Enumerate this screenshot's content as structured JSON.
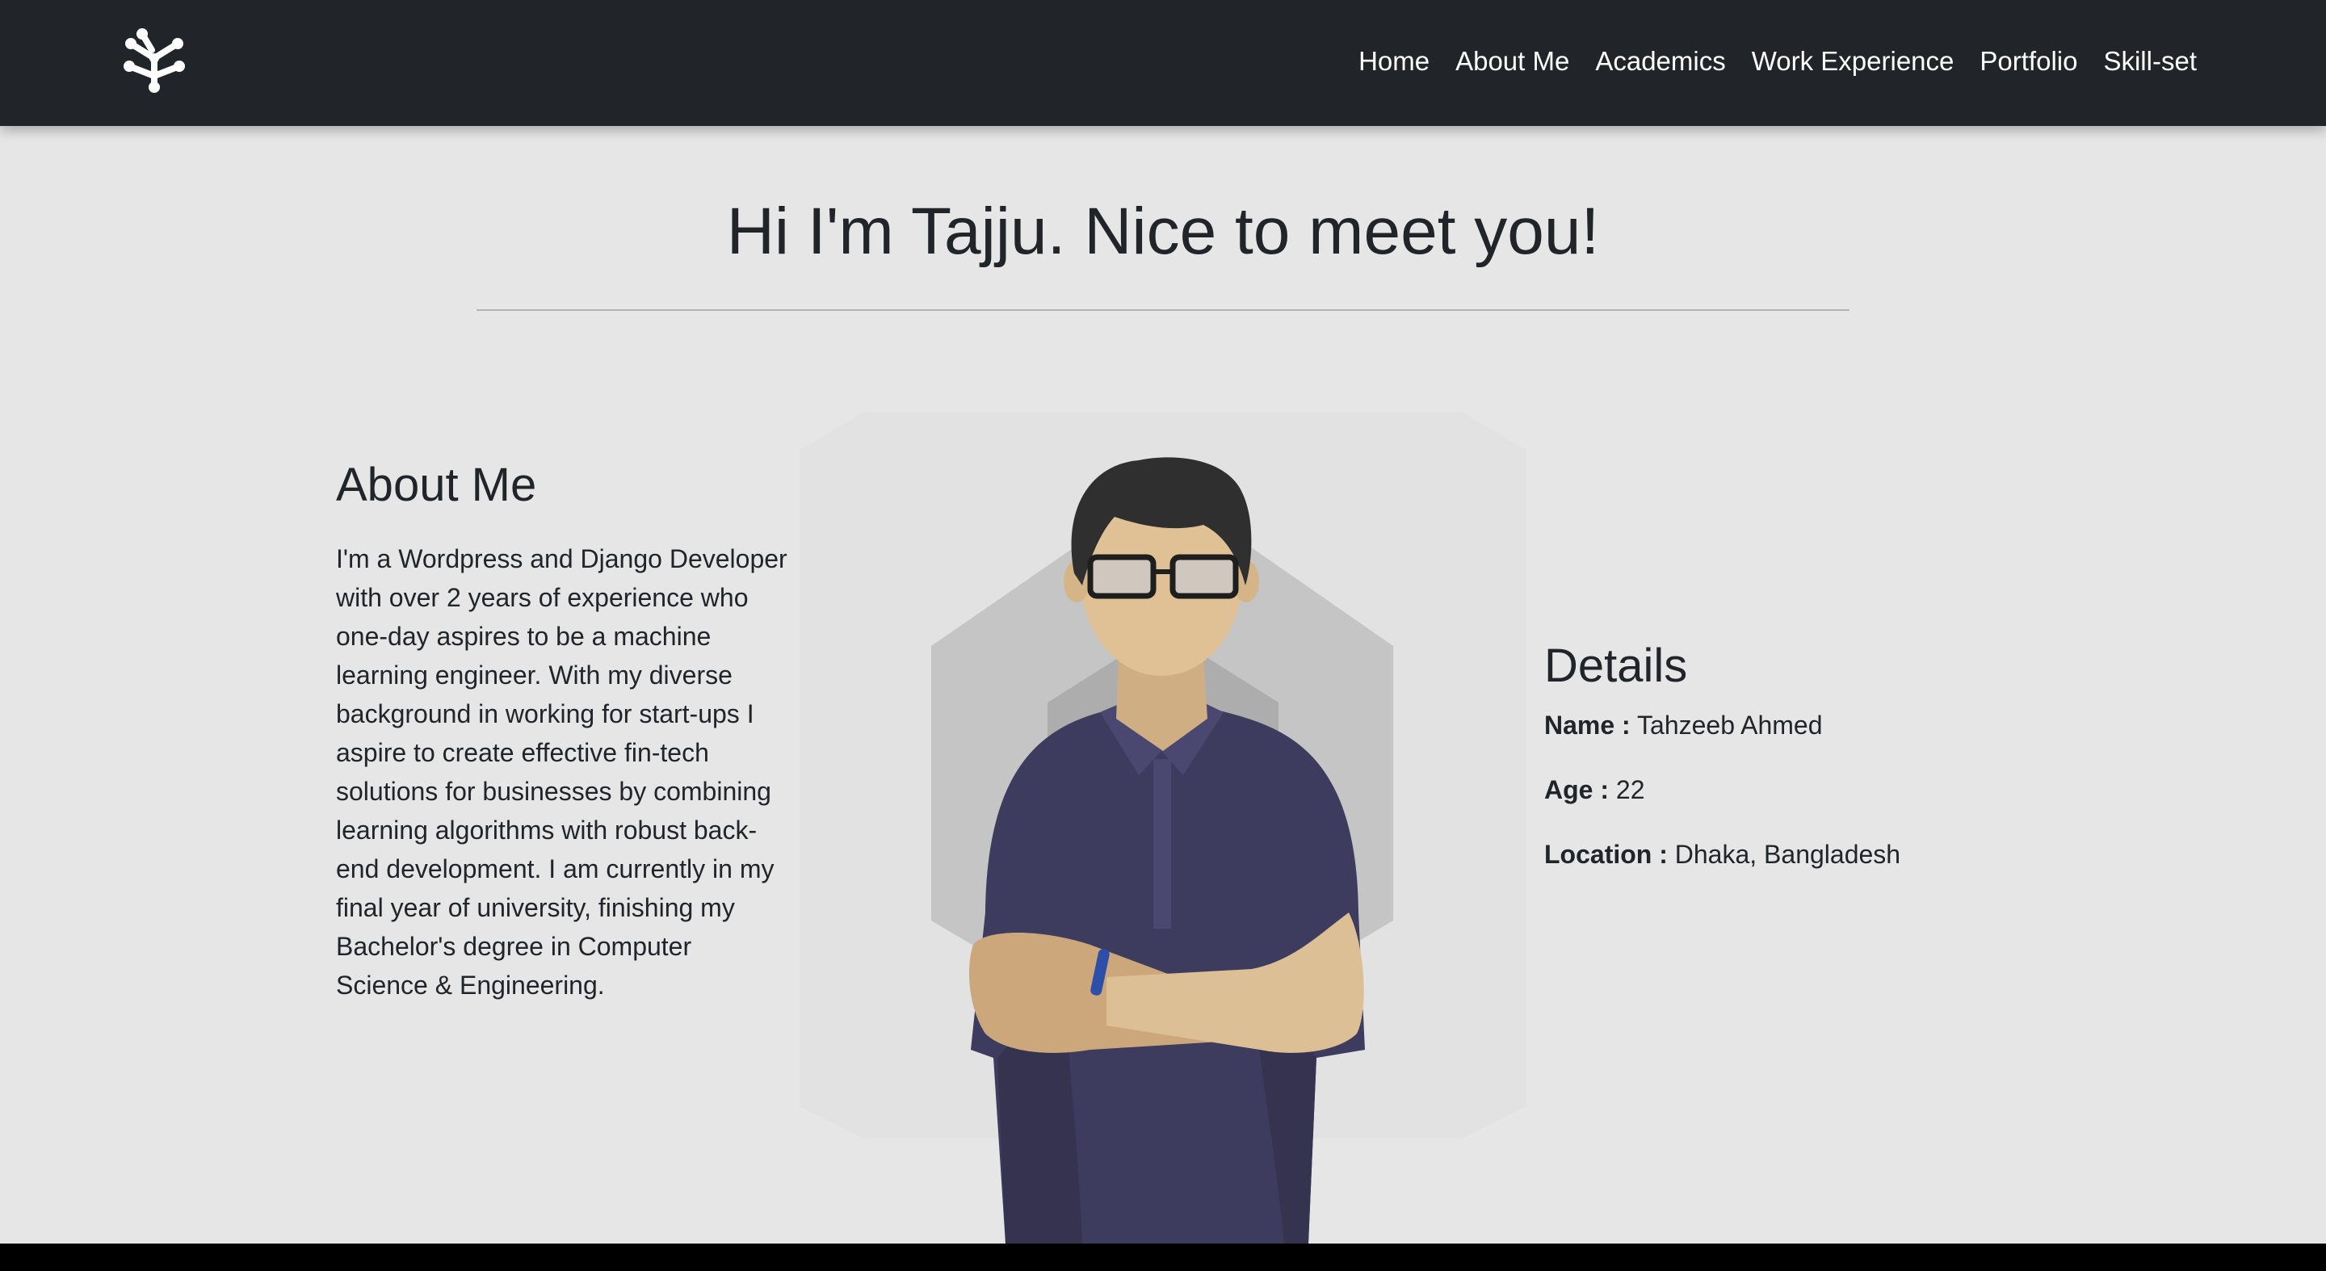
{
  "nav": {
    "logo_icon": "network-tree-icon",
    "links": [
      "Home",
      "About Me",
      "Academics",
      "Work Experience",
      "Portfolio",
      "Skill-set"
    ]
  },
  "hero": {
    "title": "Hi I'm Tajju. Nice to meet you!"
  },
  "about": {
    "heading": "About Me",
    "text": "I'm a Wordpress and Django Developer with over 2 years of experience who one-day aspires to be a machine learning engineer. With my diverse background in working for start-ups I aspire to create effective fin-tech solutions for businesses by combining learning algorithms with robust back-end development. I am currently in my final year of university, finishing my Bachelor's degree in Computer Science & Engineering."
  },
  "portrait": {
    "icon": "developer-avatar-illustration"
  },
  "details": {
    "heading": "Details",
    "name_label": "Name :",
    "name_value": "Tahzeeb Ahmed",
    "age_label": "Age :",
    "age_value": "22",
    "location_label": "Location :",
    "location_value": "Dhaka, Bangladesh"
  },
  "colors": {
    "navbar": "#212529",
    "background": "#e6e6e6",
    "shirt": "#3d3b5e",
    "skin": "#dcbf95"
  }
}
